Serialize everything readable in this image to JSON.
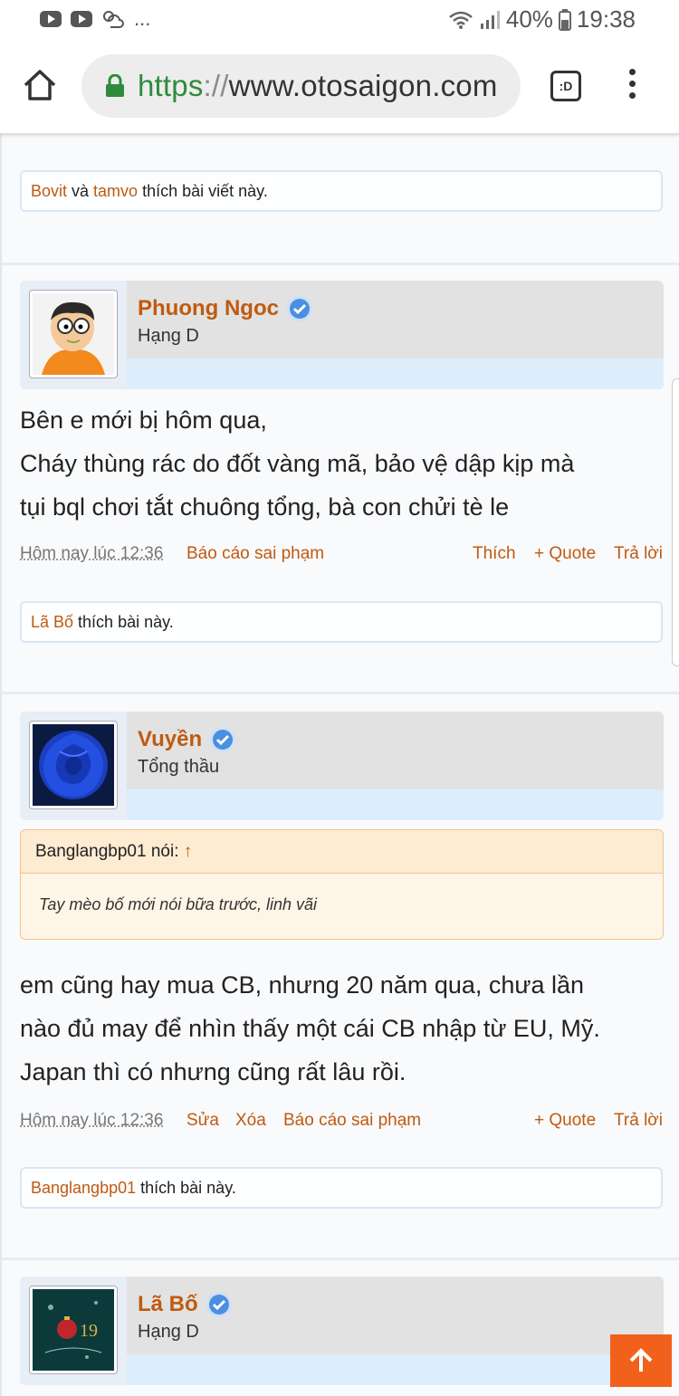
{
  "status_bar": {
    "battery": "40%",
    "time": "19:38",
    "more": "..."
  },
  "browser": {
    "url_scheme": "https",
    "url_separator": "://",
    "url_host": "www.otosaigon.com",
    "tab_switcher_label": ":D"
  },
  "posts": [
    {
      "likes": {
        "user1": "Bovit",
        "connector": " và ",
        "user2": "tamvo",
        "suffix": " thích bài viết này."
      }
    },
    {
      "author": "Phuong Ngoc",
      "rank": "Hạng D",
      "message_lines": [
        "Bên e mới bị hôm qua,",
        "Cháy thùng rác do đốt vàng mã, bảo vệ dập kịp mà",
        "tụi bql chơi tắt chuông tổng, bà con chửi tè le"
      ],
      "date": "Hôm nay lúc 12:36",
      "actions": {
        "report": "Báo cáo sai phạm",
        "like": "Thích",
        "quote": "+ Quote",
        "reply": "Trả lời"
      },
      "likes": {
        "user1": "Lã Bố",
        "suffix": " thích bài này."
      }
    },
    {
      "author": "Vuyền",
      "rank": "Tổng thầu",
      "quote": {
        "author": "Banglangbp01 nói:",
        "arrow": "↑",
        "text": "Tay mèo bố mới nói bữa trước, linh vãi"
      },
      "message_lines": [
        "em cũng hay mua CB, nhưng 20 năm qua, chưa lần",
        "nào đủ may để nhìn thấy một cái CB nhập từ EU, Mỹ.",
        "Japan thì có nhưng cũng rất lâu rồi."
      ],
      "date": "Hôm nay lúc 12:36",
      "actions": {
        "edit": "Sửa",
        "delete": "Xóa",
        "report": "Báo cáo sai phạm",
        "quote": "+ Quote",
        "reply": "Trả lời"
      },
      "likes": {
        "user1": "Banglangbp01",
        "suffix": " thích bài này."
      }
    },
    {
      "author": "Lã Bố",
      "rank": "Hạng D"
    }
  ],
  "icons": {
    "home": "home-icon",
    "lock": "lock-icon",
    "menu": "overflow-menu-icon",
    "verified": "verified-badge-icon",
    "to_top": "arrow-up-icon"
  },
  "colors": {
    "link": "#c05a10",
    "url_scheme": "#2e8b3c",
    "to_top_button": "#f2611c",
    "verified": "#4a8fe0"
  }
}
